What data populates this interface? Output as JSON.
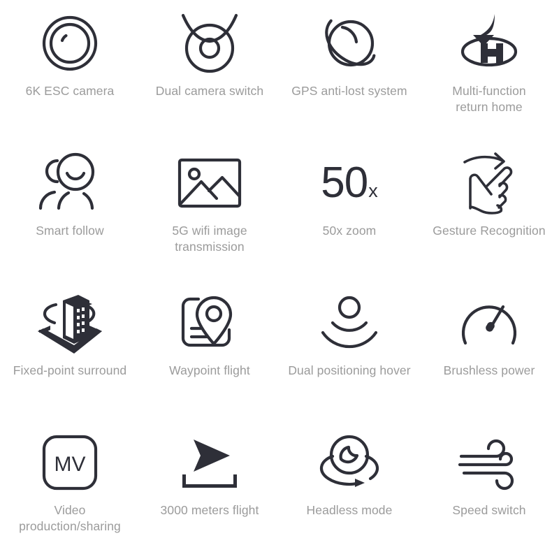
{
  "page": {
    "background_color": "#ffffff",
    "icon_color": "#2e2f38",
    "label_color": "#9b9b9b",
    "columns": 4,
    "rows": 4
  },
  "features": [
    {
      "id": 1,
      "icon": "lens-camera-icon",
      "label": "6K ESC camera"
    },
    {
      "id": 2,
      "icon": "dual-camera-switch-icon",
      "label": "Dual camera switch"
    },
    {
      "id": 3,
      "icon": "gps-orbit-icon",
      "label": "GPS anti-lost system"
    },
    {
      "id": 4,
      "icon": "return-home-helipad-icon",
      "label": "Multi-function\nreturn home"
    },
    {
      "id": 5,
      "icon": "smart-follow-people-icon",
      "label": "Smart follow"
    },
    {
      "id": 6,
      "icon": "image-transmission-icon",
      "label": "5G wifi image transmission"
    },
    {
      "id": 7,
      "icon": "zoom-50x-text-icon",
      "label": "50x zoom",
      "zoom_value": "50",
      "zoom_suffix": "x"
    },
    {
      "id": 8,
      "icon": "gesture-hand-icon",
      "label": "Gesture Recognition"
    },
    {
      "id": 9,
      "icon": "fixed-point-surround-icon",
      "label": "Fixed-point surround"
    },
    {
      "id": 10,
      "icon": "waypoint-flight-map-icon",
      "label": "Waypoint flight"
    },
    {
      "id": 11,
      "icon": "dual-positioning-hover-icon",
      "label": "Dual positioning hover"
    },
    {
      "id": 12,
      "icon": "brushless-gauge-icon",
      "label": "Brushless power"
    },
    {
      "id": 13,
      "icon": "mv-video-icon",
      "label": "Video\nproduction/sharing",
      "badge_text": "MV"
    },
    {
      "id": 14,
      "icon": "flight-distance-arrow-icon",
      "label": "3000 meters flight"
    },
    {
      "id": 15,
      "icon": "headless-mode-icon",
      "label": "Headless mode"
    },
    {
      "id": 16,
      "icon": "wind-speed-switch-icon",
      "label": "Speed switch"
    }
  ]
}
